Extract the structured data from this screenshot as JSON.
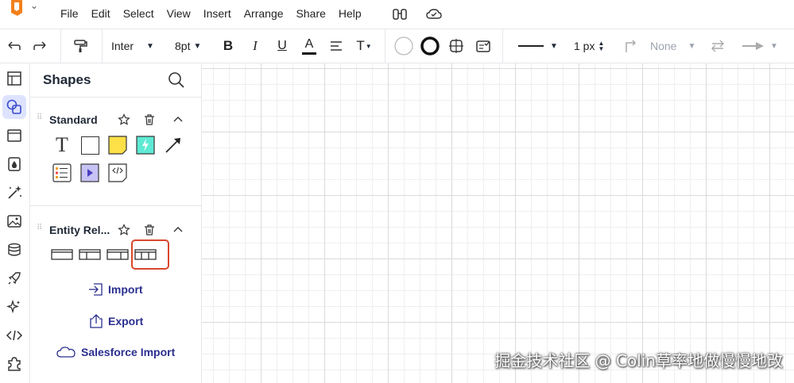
{
  "menubar": {
    "items": [
      "File",
      "Edit",
      "Select",
      "View",
      "Insert",
      "Arrange",
      "Share",
      "Help"
    ],
    "icons": [
      "binoculars-icon",
      "cloud-check-icon"
    ]
  },
  "toolbar": {
    "font_family": "Inter",
    "font_size": "8pt",
    "bold_label": "B",
    "italic_label": "I",
    "underline_label": "U",
    "font_color_label": "A",
    "text_options_label": "T",
    "line_width": "1 px",
    "arrow_start": "None"
  },
  "panel": {
    "title": "Shapes",
    "standard": {
      "title": "Standard"
    },
    "entity": {
      "title": "Entity Rel..."
    },
    "import_label": "Import",
    "export_label": "Export",
    "salesforce_label": "Salesforce Import"
  },
  "colors": {
    "accent": "#2b2f8f",
    "highlight": "#d9472b",
    "active_rail": "#dde3ff",
    "sticky": "#fde047",
    "teal": "#5eead4",
    "purple": "#c7c3f4"
  },
  "watermark": "掘金技术社区 @ Colin草率地做慢慢地改"
}
